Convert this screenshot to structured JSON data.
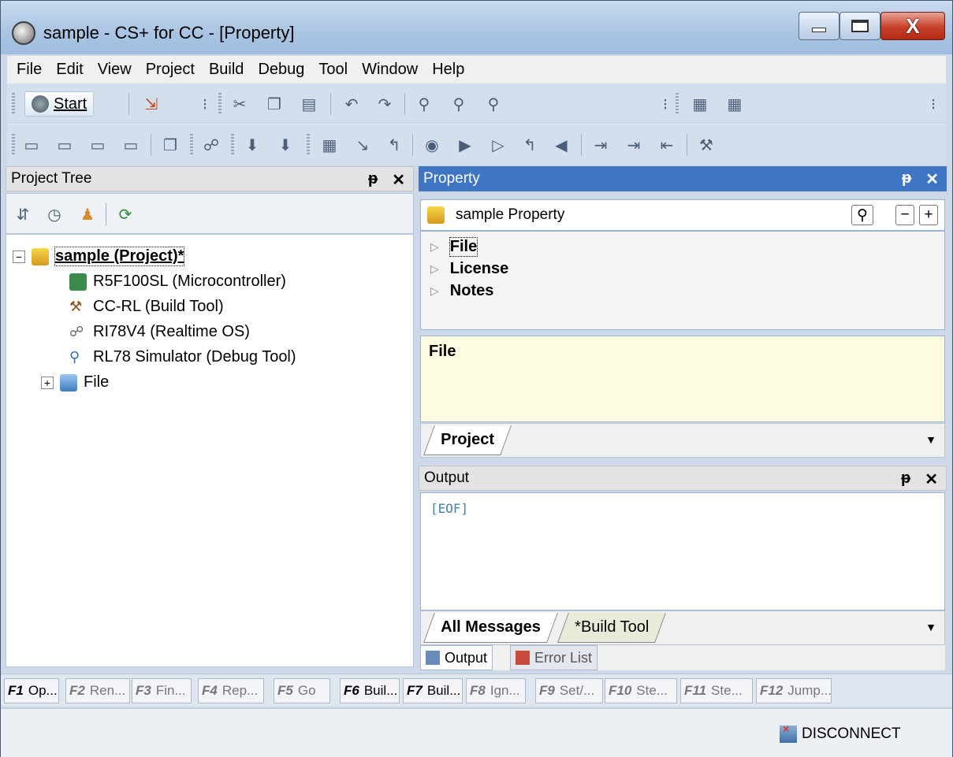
{
  "window": {
    "title": "sample - CS+ for CC - [Property]"
  },
  "menu": [
    "File",
    "Edit",
    "View",
    "Project",
    "Build",
    "Debug",
    "Tool",
    "Window",
    "Help"
  ],
  "toolbar": {
    "start_label": "Start"
  },
  "project_tree": {
    "title": "Project Tree",
    "items": [
      {
        "label": "sample (Project)*",
        "icon": "project-icon",
        "expander": "−"
      },
      {
        "label": "R5F100SL (Microcontroller)",
        "icon": "chip-icon"
      },
      {
        "label": "CC-RL (Build Tool)",
        "icon": "hammer-icon"
      },
      {
        "label": "RI78V4 (Realtime OS)",
        "icon": "os-icon"
      },
      {
        "label": "RL78 Simulator (Debug Tool)",
        "icon": "debug-tool-icon"
      },
      {
        "label": "File",
        "icon": "folder-icon",
        "expander": "+"
      }
    ]
  },
  "property": {
    "title": "Property",
    "subtitle": "sample Property",
    "categories": [
      "File",
      "License",
      "Notes"
    ],
    "description": "File",
    "tab": "Project",
    "btn_minus": "−",
    "btn_plus": "+"
  },
  "output": {
    "title": "Output",
    "text": "[EOF]",
    "tabs": [
      "All Messages",
      "*Build Tool"
    ],
    "bottom_tabs": [
      "Output",
      "Error List"
    ]
  },
  "panel_buttons": {
    "pin": "ᵽ",
    "close": "✕"
  },
  "fkeys": [
    {
      "key": "F1",
      "label": "Op..."
    },
    {
      "key": "F2",
      "label": "Ren..."
    },
    {
      "key": "F3",
      "label": "Fin..."
    },
    {
      "key": "F4",
      "label": "Rep..."
    },
    {
      "key": "F5",
      "label": "Go"
    },
    {
      "key": "F6",
      "label": "Buil..."
    },
    {
      "key": "F7",
      "label": "Buil..."
    },
    {
      "key": "F8",
      "label": "Ign..."
    },
    {
      "key": "F9",
      "label": "Set/..."
    },
    {
      "key": "F10",
      "label": "Ste..."
    },
    {
      "key": "F11",
      "label": "Ste..."
    },
    {
      "key": "F12",
      "label": "Jump..."
    }
  ],
  "status": {
    "disconnect": "DISCONNECT"
  }
}
